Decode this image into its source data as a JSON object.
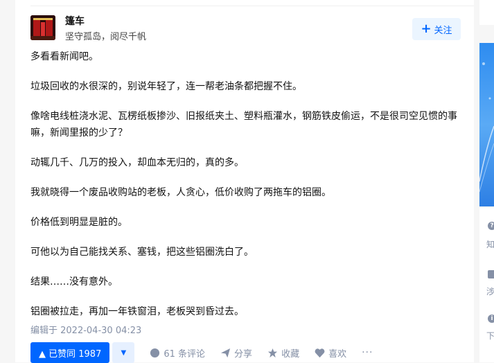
{
  "author": {
    "name": "篷车",
    "bio": "坚守孤岛，阅尽千帆",
    "follow_label": "关注"
  },
  "content": {
    "paragraphs": [
      "多看看新闻吧。",
      "垃圾回收的水很深的，别说年轻了，连一帮老油条都把握不住。",
      "像啥电线桩浇水泥、瓦楞纸板掺沙、旧报纸夹土、塑料瓶灌水，钢筋铁皮偷运，不是很司空见惯的事嘛，新闻里报的少了？",
      "动辄几千、几万的投入，却血本无归的，真的多。",
      "我就晓得一个废品收购站的老板，人贪心，低价收购了两拖车的铝圈。",
      "价格低到明显是脏的。",
      "可他以为自己能找关系、塞钱，把这些铝圈洗白了。",
      "结果……没有意外。",
      "铝圈被拉走，再加一年铁窗泪，老板哭到昏过去。"
    ],
    "edited": "编辑于 2022-04-30 04:23"
  },
  "actions": {
    "vote_label": "▲ 已赞同 1987",
    "comments": "61 条评论",
    "share": "分享",
    "favorite": "收藏",
    "like": "喜欢",
    "more": "···"
  },
  "sidebar": {
    "item1": "知乎",
    "item2": "涉未",
    "item3": "下载"
  },
  "colors": {
    "accent": "#0066ff",
    "muted": "#8590a6"
  }
}
